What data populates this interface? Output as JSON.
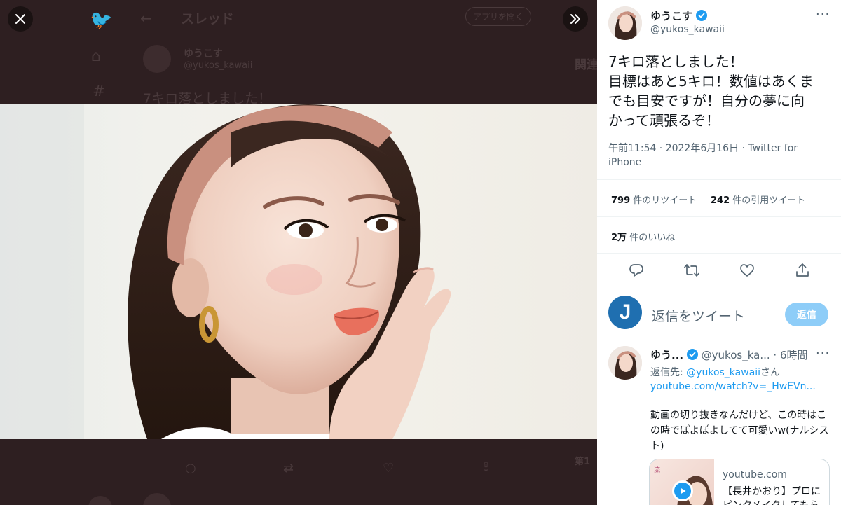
{
  "background": {
    "header_title": "スレッド",
    "open_app": "アプリを開く",
    "author_name": "ゆうこす",
    "author_handle": "@yukos_kawaii",
    "tweet_preview": "7キロ落としました！",
    "side_label": "関連",
    "side_label2": "第1"
  },
  "tweet": {
    "display_name": "ゆうこす",
    "handle": "@yukos_kawaii",
    "text_lines": [
      "7キロ落としました！",
      "目標はあと5キロ！数値はあくま",
      "でも目安ですが！自分の夢に向",
      "かって頑張るぞ！"
    ],
    "meta_line1": "午前11:54 · 2022年6月16日 · Twitter for",
    "meta_line2": "iPhone",
    "retweets_count": "799",
    "retweets_label": "件のリツイート",
    "quotes_count": "242",
    "quotes_label": "件の引用ツイート",
    "likes_count": "2万",
    "likes_label": "件のいいね"
  },
  "reply_box": {
    "placeholder": "返信をツイート",
    "button": "返信",
    "avatar_letter": "J"
  },
  "reply": {
    "display_name": "ゆう...",
    "handle": "@yukos_ka...",
    "time": "· 6時間",
    "replying_to_prefix": "返信先: ",
    "replying_to_handle": "@yukos_kawaii",
    "replying_to_suffix": "さん",
    "link": "youtube.com/watch?v=_HwEVn...",
    "text_lines": [
      "動画の切り抜きなんだけど、この時はこ",
      "の時でぽよぽよしてて可愛いw(ナルシス",
      "ト)"
    ],
    "card_domain": "youtube.com",
    "card_title_line1": "【長井かおり】プロに",
    "card_title_line2": "ピンクメイクしてもら"
  },
  "colors": {
    "accent": "#1d9bf0",
    "reply_button_disabled": "#8ecdf8",
    "backdrop": "#2e1f21"
  }
}
